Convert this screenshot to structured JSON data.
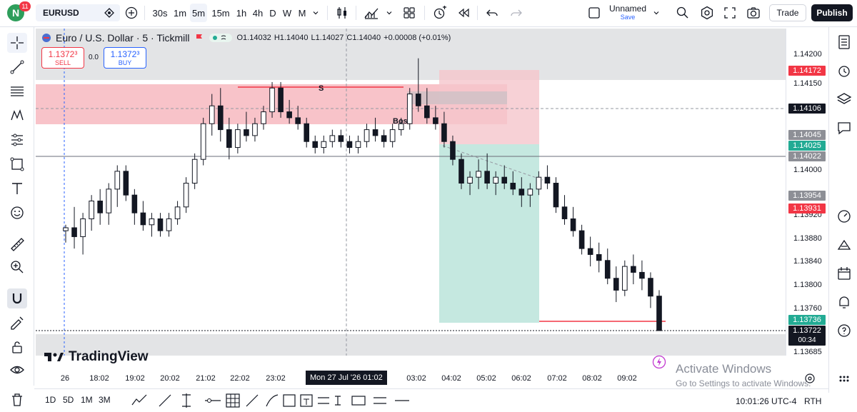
{
  "header": {
    "notification_count": "11",
    "logo_letter": "N",
    "symbol": "EURUSD",
    "timeframes": [
      "30s",
      "1m",
      "5m",
      "15m",
      "1h",
      "4h",
      "D",
      "W",
      "M"
    ],
    "active_timeframe": "5m",
    "layout_name": "Unnamed",
    "layout_save": "Save",
    "trade_label": "Trade",
    "publish_label": "Publish"
  },
  "legend": {
    "title": "Euro / U.S. Dollar · 5 · Tickmill",
    "open": "O1.14032",
    "high": "H1.14040",
    "low": "L1.14027",
    "close": "C1.14040",
    "change": "+0.00008 (+0.01%)",
    "sell_price": "1.1372³",
    "sell_label": "SELL",
    "spread": "0.0",
    "buy_price": "1.1372³",
    "buy_label": "BUY"
  },
  "annotations": {
    "s_label": "S",
    "bos_label": "Bos"
  },
  "price_axis": {
    "ticks": [
      "1.14200",
      "1.14150",
      "1.14000",
      "1.13920",
      "1.13880",
      "1.13840",
      "1.13800",
      "1.13760",
      "1.13685"
    ],
    "tags": [
      {
        "value": "1.14172",
        "color": "#f23645"
      },
      {
        "value": "1.14106",
        "color": "#131722"
      },
      {
        "value": "1.14045",
        "color": "#8d8f96"
      },
      {
        "value": "1.14025",
        "color": "#22ab94"
      },
      {
        "value": "1.14022",
        "color": "#8d8f96"
      },
      {
        "value": "1.13954",
        "color": "#8d8f96"
      },
      {
        "value": "1.13931",
        "color": "#f23645"
      },
      {
        "value": "1.13736",
        "color": "#22ab94"
      },
      {
        "value": "1.13722",
        "color": "#131722"
      }
    ],
    "countdown": "00:34"
  },
  "time_axis": {
    "ticks": [
      "26",
      "18:02",
      "19:02",
      "20:02",
      "21:02",
      "22:02",
      "23:02",
      "03:02",
      "04:02",
      "05:02",
      "06:02",
      "07:02",
      "08:02",
      "09:02"
    ],
    "cursor": "Mon 27 Jul '26  01:02"
  },
  "watermark": "TradingView",
  "bottom": {
    "ranges": [
      "1D",
      "5D",
      "1M",
      "3M"
    ],
    "clock": "10:01:26 UTC-4",
    "rth": "RTH"
  },
  "system": {
    "activate_title": "Activate Windows",
    "activate_sub": "Go to Settings to activate Windows."
  },
  "chart_data": {
    "type": "candlestick",
    "symbol": "EURUSD",
    "interval": "5",
    "price_range": [
      1.1368,
      1.1423
    ],
    "candles": [
      [
        1.1389,
        1.139,
        1.1387,
        1.13895
      ],
      [
        1.13895,
        1.1393,
        1.1386,
        1.1388
      ],
      [
        1.1388,
        1.1392,
        1.1385,
        1.1391
      ],
      [
        1.1391,
        1.1395,
        1.1389,
        1.1394
      ],
      [
        1.1394,
        1.1396,
        1.139,
        1.1392
      ],
      [
        1.1392,
        1.1397,
        1.139,
        1.1396
      ],
      [
        1.1396,
        1.14,
        1.1393,
        1.1399
      ],
      [
        1.1399,
        1.14,
        1.1394,
        1.1395
      ],
      [
        1.1395,
        1.1396,
        1.139,
        1.1392
      ],
      [
        1.1392,
        1.1394,
        1.1389,
        1.139
      ],
      [
        1.139,
        1.1392,
        1.1388,
        1.1391
      ],
      [
        1.1391,
        1.1392,
        1.1388,
        1.1389
      ],
      [
        1.1389,
        1.1392,
        1.1388,
        1.1391
      ],
      [
        1.1391,
        1.1394,
        1.139,
        1.1393
      ],
      [
        1.1393,
        1.1398,
        1.1392,
        1.1397
      ],
      [
        1.1397,
        1.1402,
        1.1396,
        1.1401
      ],
      [
        1.1401,
        1.1408,
        1.14,
        1.1407
      ],
      [
        1.1407,
        1.1412,
        1.1405,
        1.141
      ],
      [
        1.141,
        1.1413,
        1.1404,
        1.1406
      ],
      [
        1.1406,
        1.1408,
        1.1401,
        1.1403
      ],
      [
        1.1403,
        1.1407,
        1.1402,
        1.1406
      ],
      [
        1.1406,
        1.1409,
        1.1404,
        1.1405
      ],
      [
        1.1405,
        1.1408,
        1.1404,
        1.1407
      ],
      [
        1.1407,
        1.141,
        1.1406,
        1.1409
      ],
      [
        1.1409,
        1.1414,
        1.1408,
        1.1413
      ],
      [
        1.1413,
        1.1414,
        1.1408,
        1.1409
      ],
      [
        1.1409,
        1.1411,
        1.1407,
        1.1408
      ],
      [
        1.1408,
        1.141,
        1.1406,
        1.1407
      ],
      [
        1.1407,
        1.1408,
        1.1403,
        1.1404
      ],
      [
        1.1404,
        1.1405,
        1.1402,
        1.1403
      ],
      [
        1.1403,
        1.1405,
        1.1402,
        1.1404
      ],
      [
        1.1404,
        1.1406,
        1.1403,
        1.1405
      ],
      [
        1.1405,
        1.1406,
        1.1403,
        1.1404
      ],
      [
        1.1404,
        1.1405,
        1.1402,
        1.1403
      ],
      [
        1.1403,
        1.1405,
        1.1402,
        1.1404
      ],
      [
        1.1404,
        1.1407,
        1.1403,
        1.1406
      ],
      [
        1.1406,
        1.1408,
        1.1404,
        1.1405
      ],
      [
        1.1405,
        1.1406,
        1.1403,
        1.1404
      ],
      [
        1.1404,
        1.1407,
        1.1403,
        1.1406
      ],
      [
        1.1406,
        1.1408,
        1.1405,
        1.1407
      ],
      [
        1.1407,
        1.1413,
        1.1406,
        1.1412
      ],
      [
        1.1412,
        1.1418,
        1.1409,
        1.141
      ],
      [
        1.141,
        1.1413,
        1.1407,
        1.1408
      ],
      [
        1.1408,
        1.141,
        1.1406,
        1.1407
      ],
      [
        1.1407,
        1.1409,
        1.1403,
        1.1404
      ],
      [
        1.1404,
        1.1405,
        1.14,
        1.1401
      ],
      [
        1.1401,
        1.1402,
        1.1396,
        1.1397
      ],
      [
        1.1397,
        1.1399,
        1.1395,
        1.1398
      ],
      [
        1.1398,
        1.1401,
        1.1396,
        1.1399
      ],
      [
        1.1399,
        1.1402,
        1.1396,
        1.1397
      ],
      [
        1.1397,
        1.1399,
        1.1395,
        1.1398
      ],
      [
        1.1398,
        1.14,
        1.1396,
        1.1397
      ],
      [
        1.1397,
        1.1399,
        1.1395,
        1.1396
      ],
      [
        1.1396,
        1.1398,
        1.1393,
        1.1395
      ],
      [
        1.1395,
        1.1397,
        1.1393,
        1.1396
      ],
      [
        1.1396,
        1.1399,
        1.1395,
        1.1398
      ],
      [
        1.1398,
        1.14,
        1.1396,
        1.1397
      ],
      [
        1.1397,
        1.1398,
        1.1392,
        1.1393
      ],
      [
        1.1393,
        1.1395,
        1.139,
        1.1391
      ],
      [
        1.1391,
        1.1393,
        1.1388,
        1.1389
      ],
      [
        1.1389,
        1.139,
        1.1385,
        1.1386
      ],
      [
        1.1386,
        1.1388,
        1.1383,
        1.1385
      ],
      [
        1.1385,
        1.1387,
        1.1382,
        1.1384
      ],
      [
        1.1384,
        1.1386,
        1.138,
        1.1381
      ],
      [
        1.1381,
        1.1383,
        1.1377,
        1.1379
      ],
      [
        1.1379,
        1.1384,
        1.1378,
        1.1383
      ],
      [
        1.1383,
        1.1385,
        1.138,
        1.1382
      ],
      [
        1.1382,
        1.1384,
        1.1379,
        1.1381
      ],
      [
        1.1381,
        1.1382,
        1.1376,
        1.1378
      ],
      [
        1.1378,
        1.1379,
        1.1374,
        1.13722
      ]
    ]
  }
}
